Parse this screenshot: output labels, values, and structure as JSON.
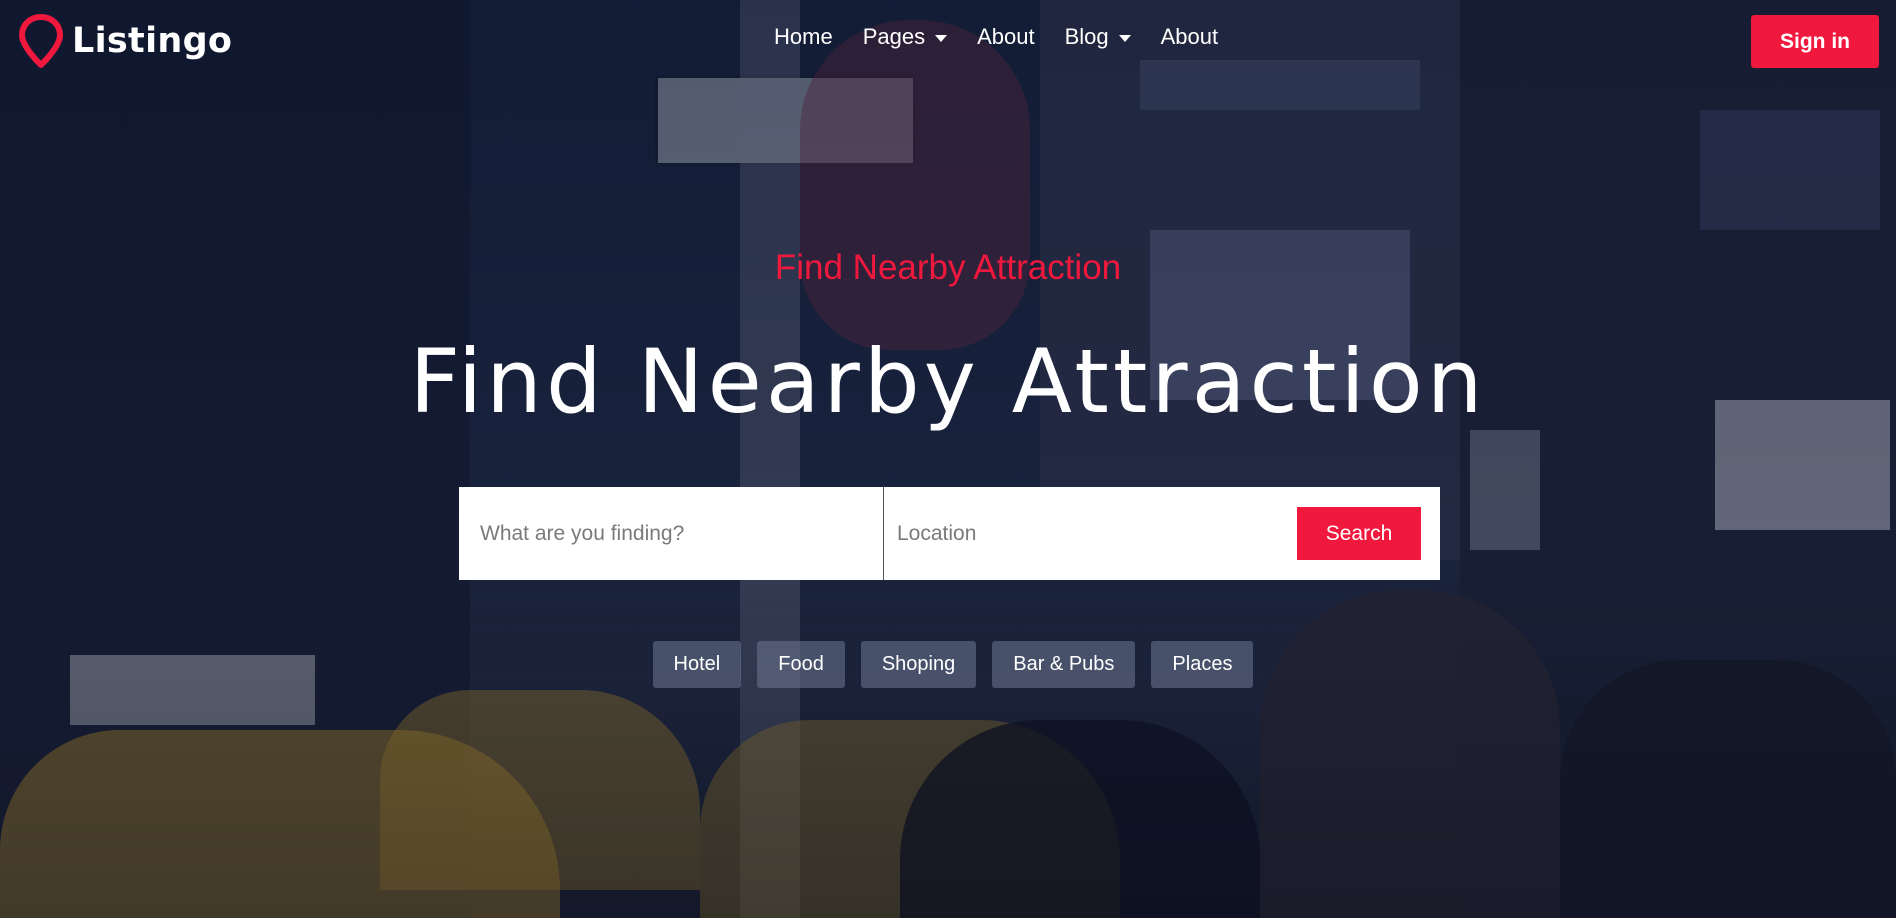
{
  "brand": {
    "name": "Listingo",
    "logo_icon": "map-pin-icon",
    "accent": "#f1183e"
  },
  "nav": {
    "items": [
      {
        "label": "Home",
        "dropdown": false
      },
      {
        "label": "Pages",
        "dropdown": true
      },
      {
        "label": "About",
        "dropdown": false
      },
      {
        "label": "Blog",
        "dropdown": true
      },
      {
        "label": "About",
        "dropdown": false
      }
    ],
    "signin_label": "Sign in"
  },
  "hero": {
    "eyebrow": "Find Nearby Attraction",
    "headline": "Find Nearby Attraction"
  },
  "search": {
    "what_placeholder": "What are you finding?",
    "where_placeholder": "Location",
    "button_label": "Search"
  },
  "categories": [
    "Hotel",
    "Food",
    "Shoping",
    "Bar & Pubs",
    "Places"
  ]
}
